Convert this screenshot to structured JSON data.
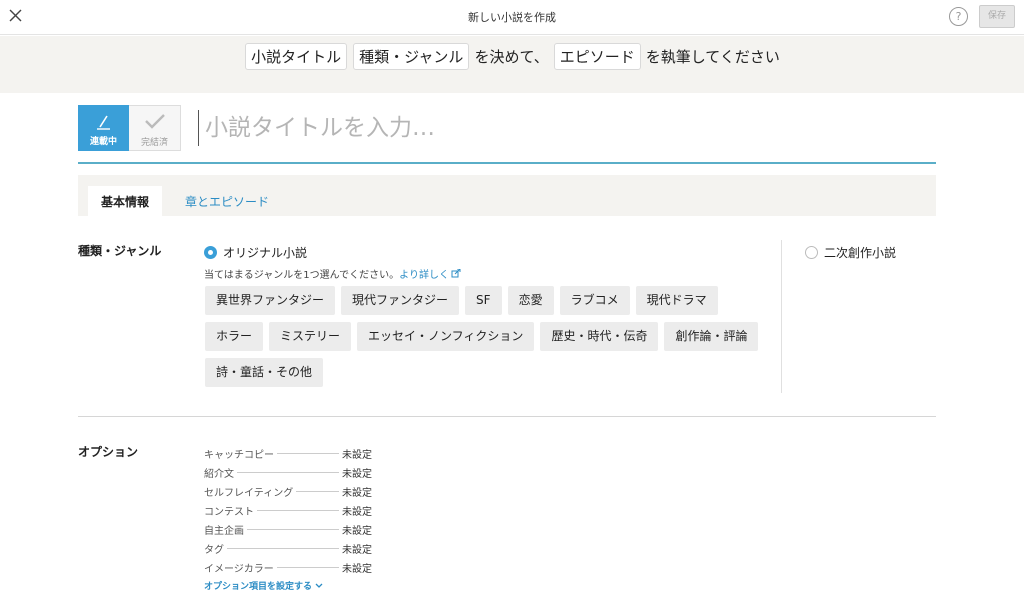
{
  "window": {
    "title": "新しい小説を作成",
    "help_label": "?",
    "save_label": "保存"
  },
  "banner": {
    "chip_title": "小説タイトル",
    "chip_genre": "種類・ジャンル",
    "text_middle": "を決めて、",
    "chip_episode": "エピソード",
    "text_end": "を執筆してください"
  },
  "status": {
    "ongoing_label": "連載中",
    "complete_label": "完結済",
    "selected": "連載中"
  },
  "title_input": {
    "placeholder": "小説タイトルを入力…",
    "value": ""
  },
  "tabs": [
    {
      "label": "基本情報",
      "active": true
    },
    {
      "label": "章とエピソード",
      "active": false
    }
  ],
  "genre_section": {
    "label": "種類・ジャンル",
    "original_label": "オリジナル小説",
    "derivative_label": "二次創作小説",
    "selected": "オリジナル小説",
    "hint": "当てはまるジャンルを1つ選んでください。",
    "more_link": "より詳しく",
    "genres": [
      "異世界ファンタジー",
      "現代ファンタジー",
      "SF",
      "恋愛",
      "ラブコメ",
      "現代ドラマ",
      "ホラー",
      "ミステリー",
      "エッセイ・ノンフィクション",
      "歴史・時代・伝奇",
      "創作論・評論",
      "詩・童話・その他"
    ]
  },
  "options_section": {
    "label": "オプション",
    "items": [
      {
        "name": "キャッチコピー",
        "value": "未設定"
      },
      {
        "name": "紹介文",
        "value": "未設定"
      },
      {
        "name": "セルフレイティング",
        "value": "未設定"
      },
      {
        "name": "コンテスト",
        "value": "未設定"
      },
      {
        "name": "自主企画",
        "value": "未設定"
      },
      {
        "name": "タグ",
        "value": "未設定"
      },
      {
        "name": "イメージカラー",
        "value": "未設定"
      }
    ],
    "configure_link": "オプション項目を設定する"
  },
  "colors": {
    "accent": "#3a9fd8",
    "link": "#2b8cc4",
    "banner_bg": "#f4f3f0"
  }
}
